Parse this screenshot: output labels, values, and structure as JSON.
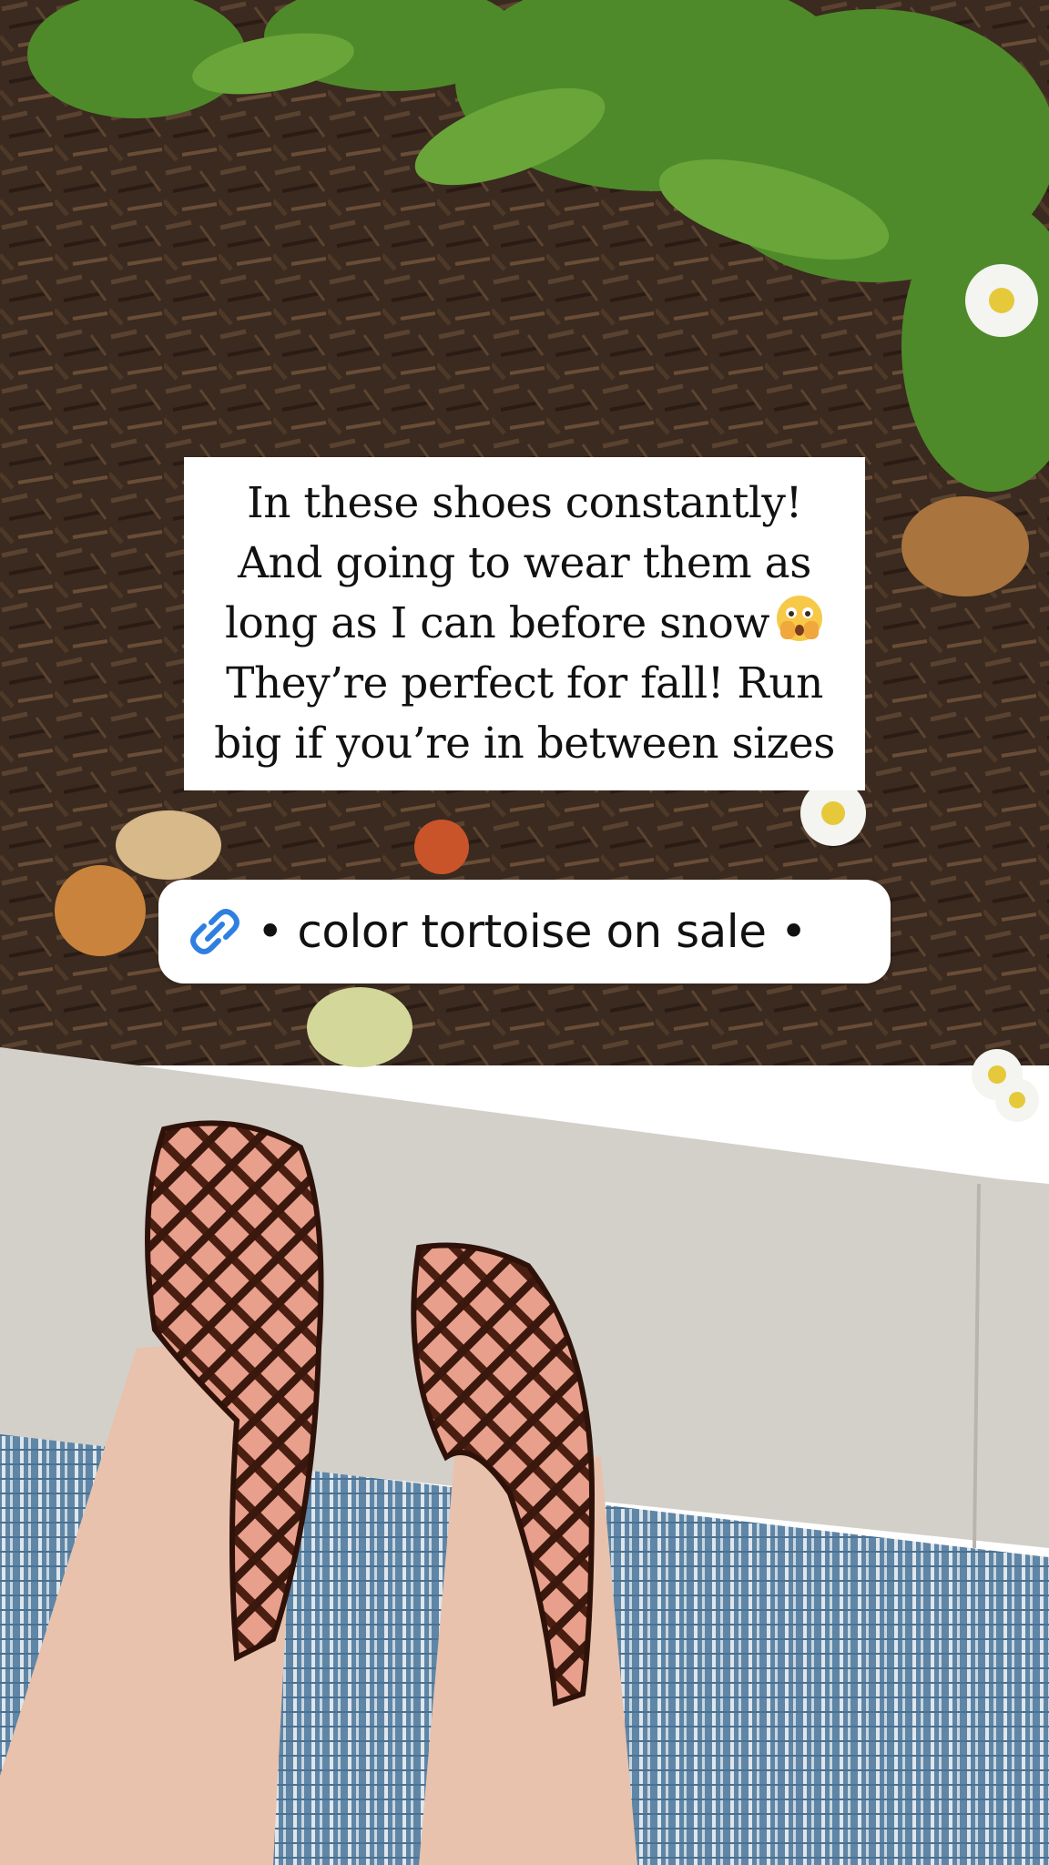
{
  "story": {
    "caption_lines": [
      "In these shoes constantly!",
      "And going to wear them as",
      "long as I can before snow",
      "They’re perfect for fall! Run",
      "big if you’re in between sizes"
    ],
    "caption_emoji": "face-with-open-eyes-and-hand-over-mouth",
    "link_sticker": {
      "icon": "link-icon",
      "text": "• color tortoise on sale •",
      "icon_color": "#2f7fe0"
    }
  }
}
